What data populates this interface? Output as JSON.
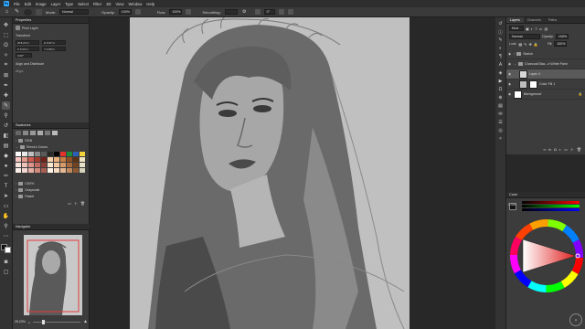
{
  "menu": {
    "app_badge": "Ps",
    "items": [
      "File",
      "Edit",
      "Image",
      "Layer",
      "Type",
      "Select",
      "Filter",
      "3D",
      "View",
      "Window",
      "Help"
    ]
  },
  "options": {
    "mode_label": "Mode:",
    "mode_value": "Normal",
    "opacity_label": "Opacity:",
    "opacity_value": "100%",
    "flow_label": "Flow:",
    "flow_value": "100%",
    "smoothing_label": "Smoothing:",
    "angle_value": "0°"
  },
  "properties": {
    "title": "Properties",
    "layer_type": "Pixel Layer",
    "transform_label": "Transform",
    "w": "W 8.23 in",
    "h": "H 6.97 in",
    "x": "X 0.23 in",
    "y": "Y 0.68 in",
    "angle": "0.00°",
    "align_label": "Align and Distribute",
    "align_sub": "Align:"
  },
  "swatches": {
    "title": "Swatches",
    "groups": [
      "RGB",
      "Elena's Colors",
      "CMYK",
      "Grayscale",
      "Pastel"
    ],
    "colors": [
      "#ffffff",
      "#e8e8e8",
      "#c0c0c0",
      "#8a8a8a",
      "#5a5a5a",
      "#2a2a2a",
      "#000000",
      "#e3322b",
      "#1f8a3a",
      "#2b5fb8",
      "#f2d33a",
      "#f4c7c0",
      "#e79a8c",
      "#d05c4f",
      "#a33a2d",
      "#6e2219",
      "#f6d3ae",
      "#e9b27c",
      "#c67e44",
      "#8f4f22",
      "#5c3217",
      "#f0e3c1",
      "#f7e2de",
      "#eec2bb",
      "#dc948a",
      "#c26b60",
      "#8a4036",
      "#fae6cf",
      "#f1c8a0",
      "#d99a6a",
      "#a86a3c",
      "#73431f",
      "#e6e0c8",
      "#fbeee9",
      "#f3d6cf",
      "#e5b0a5",
      "#d08a7d",
      "#a75f53",
      "#fff3e6",
      "#f7dcc3",
      "#e6b893",
      "#c18a5e",
      "#8e5a32",
      "#d8d2bd"
    ]
  },
  "navigator": {
    "title": "Navigator",
    "zoom": "25.23%"
  },
  "layers": {
    "tabs": [
      "Layers",
      "Channels",
      "Paths"
    ],
    "kind": "Kind",
    "blend": "Normal",
    "opacity_label": "Opacity:",
    "opacity_value": "100%",
    "lock_label": "Lock:",
    "fill_label": "Fill:",
    "fill_value": "100%",
    "rows": [
      {
        "name": "Sketch"
      },
      {
        "name": "Charcoal Blac...d White Paint"
      },
      {
        "name": "Layer 4"
      },
      {
        "name": "Color Fill 1"
      },
      {
        "name": "Background"
      }
    ]
  },
  "color": {
    "title": "Color",
    "label": "Color"
  },
  "colors": {
    "accent": "#31a8ff",
    "selected_row": "#5a5a5a"
  }
}
